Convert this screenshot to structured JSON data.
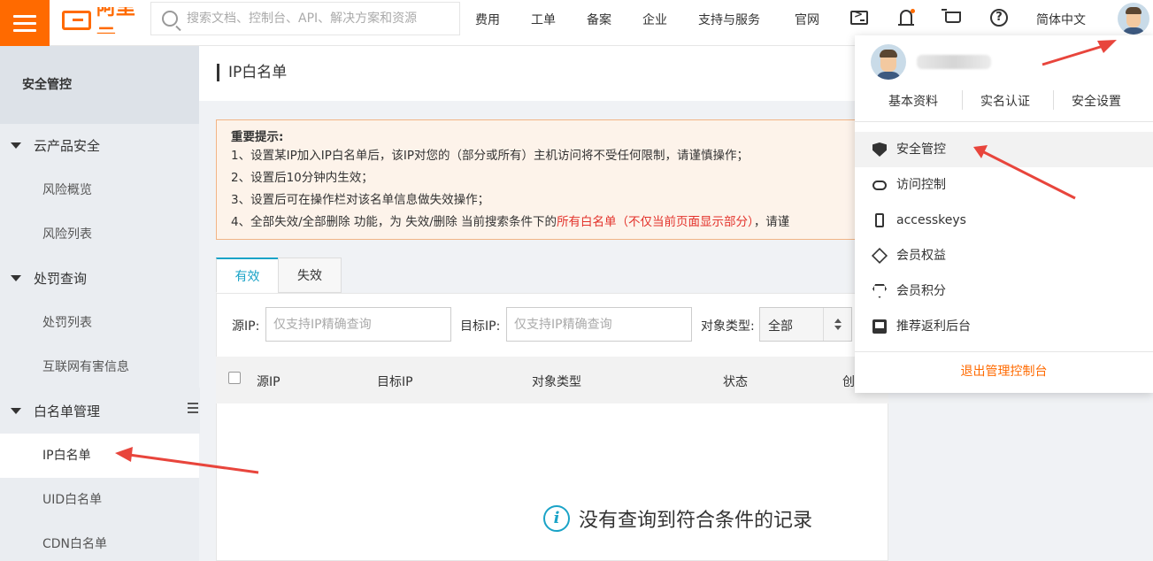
{
  "header": {
    "brand_text": "阿里云",
    "search_placeholder": "搜索文档、控制台、API、解决方案和资源",
    "nav": [
      "费用",
      "工单",
      "备案",
      "企业",
      "支持与服务",
      "官网"
    ],
    "icons": [
      "terminal-icon",
      "bell-icon",
      "cart-icon",
      "help-icon"
    ],
    "language": "简体中文"
  },
  "sidebar": {
    "title": "安全管控",
    "groups": [
      {
        "label": "云产品安全",
        "items": [
          "风险概览",
          "风险列表"
        ]
      },
      {
        "label": "处罚查询",
        "items": [
          "处罚列表",
          "互联网有害信息"
        ]
      },
      {
        "label": "白名单管理",
        "items": [
          "IP白名单",
          "UID白名单",
          "CDN白名单"
        ]
      }
    ]
  },
  "page": {
    "title": "IP白名单"
  },
  "notice": {
    "title": "重要提示:",
    "lines": [
      "1、设置某IP加入IP白名单后，该IP对您的（部分或所有）主机访问将不受任何限制，请谨慎操作；",
      "2、设置后10分钟内生效；",
      "3、设置后可在操作栏对该名单信息做失效操作；"
    ],
    "line4_prefix": "4、全部失效/全部删除 功能，为 失效/删除 当前搜索条件下的",
    "line4_red": "所有白名单（不仅当前页面显示部分）",
    "line4_suffix": "，请谨"
  },
  "tabs": [
    "有效",
    "失效"
  ],
  "filters": {
    "source_label": "源IP:",
    "source_placeholder": "仅支持IP精确查询",
    "target_label": "目标IP:",
    "target_placeholder": "仅支持IP精确查询",
    "type_label": "对象类型:",
    "type_value": "全部"
  },
  "table": {
    "columns": [
      "源IP",
      "目标IP",
      "对象类型",
      "状态",
      "创"
    ],
    "empty_text": "没有查询到符合条件的记录"
  },
  "dropdown": {
    "links": [
      "基本资料",
      "实名认证",
      "安全设置"
    ],
    "items": [
      "安全管控",
      "访问控制",
      "accesskeys",
      "会员权益",
      "会员积分",
      "推荐返利后台"
    ],
    "logout": "退出管理控制台"
  },
  "colors": {
    "brand": "#ff6a00",
    "accent": "#1aa3c7",
    "warning_text": "#e3322b",
    "annotation_arrow": "#e8453c"
  }
}
